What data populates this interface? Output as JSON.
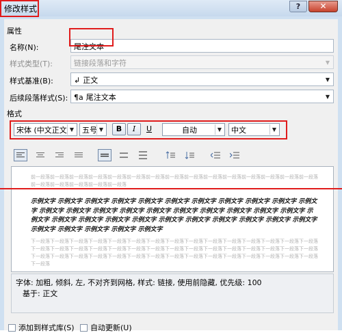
{
  "window": {
    "title": "修改样式",
    "help": "?",
    "close": "✕"
  },
  "properties": {
    "header": "属性",
    "name": {
      "label": "名称(N):",
      "value": "尾注文本"
    },
    "style_type": {
      "label": "样式类型(T):",
      "value": "链接段落和字符"
    },
    "style_based_on": {
      "label": "样式基准(B):",
      "icon": "↲",
      "value": "正文"
    },
    "next_style": {
      "label": "后续段落样式(S):",
      "icon": "¶a",
      "value": "尾注文本"
    }
  },
  "format": {
    "header": "格式",
    "font_latin": "宋体 (中文正文)",
    "font_size": "五号",
    "bold": "B",
    "italic": "I",
    "underline": "U",
    "color": "自动",
    "script": "中文"
  },
  "preview": {
    "prev_para": "前一段落前一段落前一段落前一段落前一段落前一段落前一段落前一段落前一段落前一段落前一段落前一段落前一段落前一段落前一段落前一段落前一段落前一段落前一段落前一段落",
    "sample": "示例文字 示例文字 示例文字 示例文字 示例文字 示例文字 示例文字 示例文字 示例文字 示例文字 示例文字 示例文字 示例文字 示例文字 示例文字 示例文字 示例文字 示例文字 示例文字 示例文字 示例文字 示例文字 示例文字 示例文字 示例文字 示例文字 示例文字 示例文字 示例文字 示例文字 示例文字 示例文字 示例文字 示例文字 示例文字 示例文字 示例文字",
    "next_para": "下一段落下一段落下一段落下一段落下一段落下一段落下一段落下一段落下一段落下一段落下一段落下一段落下一段落下一段落下一段落下一段落下一段落下一段落下一段落下一段落下一段落下一段落下一段落下一段落下一段落下一段落下一段落下一段落下一段落下一段落下一段落下一段落下一段落下一段落下一段落下一段落下一段落下一段落下一段落下一段落下一段落下一段落下一段落下一段落下一段落下一段落"
  },
  "description": {
    "line1": "字体: 加粗, 倾斜, 左, 不对齐到网格, 样式: 链接, 使用前隐藏, 优先级: 100",
    "line2": "基于: 正文"
  },
  "options": {
    "add_to_gallery": "添加到样式库(S)",
    "auto_update": "自动更新(U)"
  },
  "colors": {
    "highlight": "#e01b1b"
  }
}
